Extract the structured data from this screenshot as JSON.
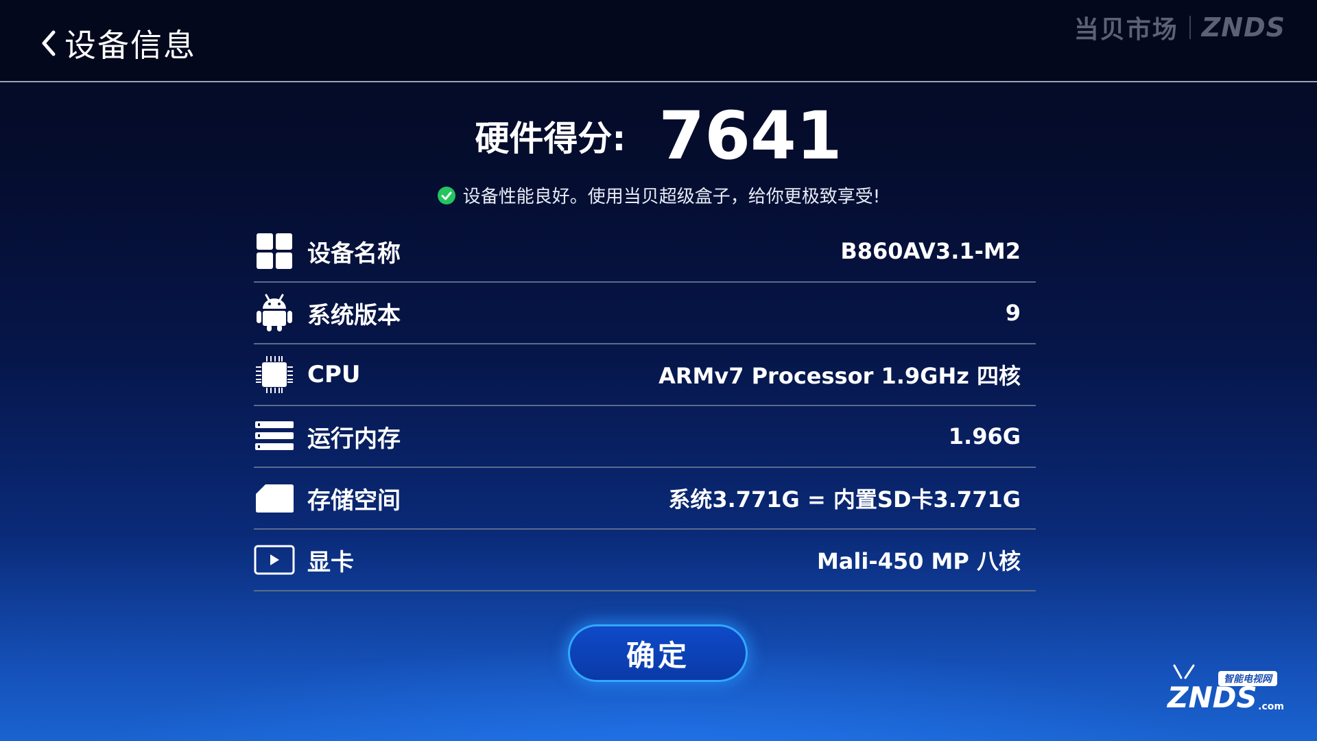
{
  "header": {
    "title": "设备信息",
    "brand_cn": "当贝市场",
    "brand_en": "ZNDS"
  },
  "score": {
    "label": "硬件得分:",
    "value": "7641"
  },
  "performance_message": "设备性能良好。使用当贝超级盒子，给你更极致享受!",
  "items": [
    {
      "label": "设备名称",
      "value": "B860AV3.1-M2",
      "icon": "grid-icon"
    },
    {
      "label": "系统版本",
      "value": "9",
      "icon": "android-icon"
    },
    {
      "label": "CPU",
      "value": "ARMv7 Processor  1.9GHz 四核",
      "icon": "chip-icon"
    },
    {
      "label": "运行内存",
      "value": "1.96G",
      "icon": "memory-icon"
    },
    {
      "label": "存储空间",
      "value": "系统3.771G = 内置SD卡3.771G",
      "icon": "sd-card-icon"
    },
    {
      "label": "显卡",
      "value": "Mali-450 MP 八核",
      "icon": "play-icon"
    }
  ],
  "confirm_button": "确定",
  "watermark": {
    "tag": "智能电视网",
    "logo": "ZNDS",
    "suffix": ".com"
  },
  "colors": {
    "accent": "#31a8ff",
    "button_bg": "#0f4ac8",
    "check": "#22c55e",
    "divider": "#5c6b8e"
  }
}
